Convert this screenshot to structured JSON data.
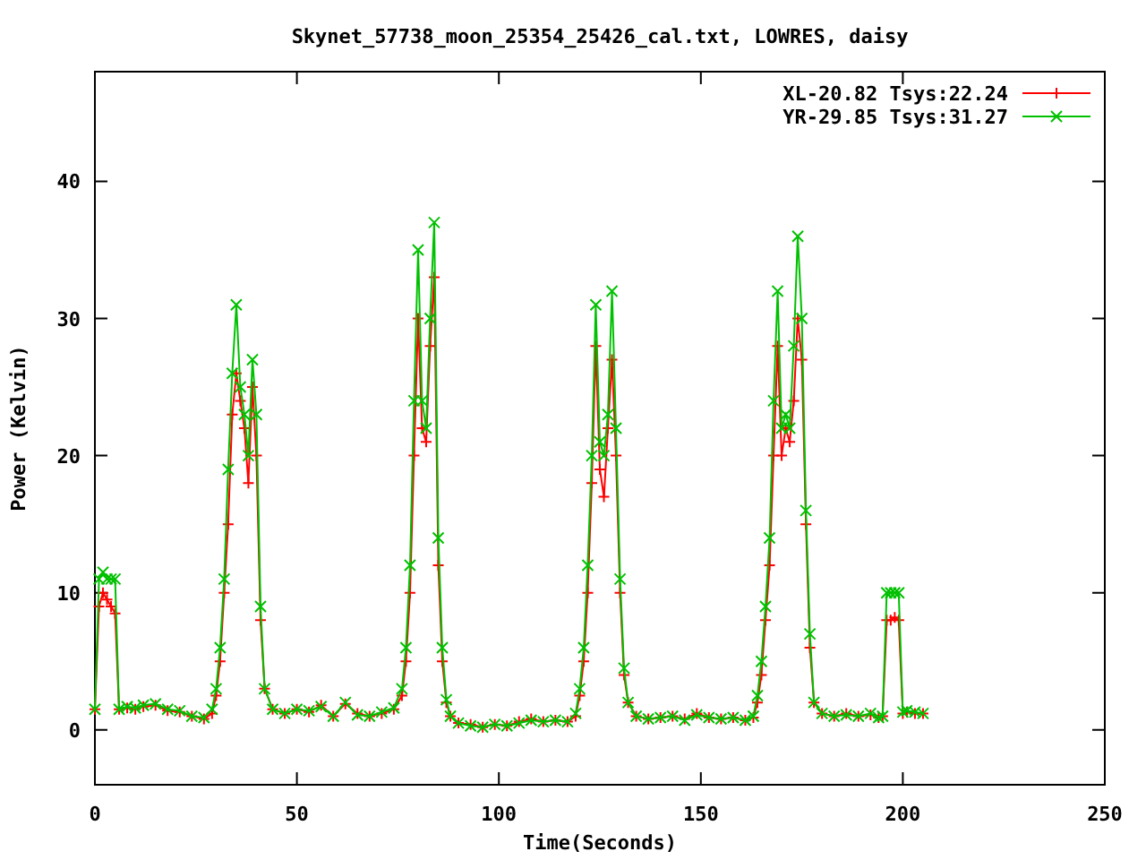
{
  "chart": {
    "chart_data": {
      "type": "line",
      "title": "Skynet_57738_moon_25354_25426_cal.txt, LOWRES, daisy",
      "xlabel": "Time(Seconds)",
      "ylabel": "Power (Kelvin)",
      "xlim": [
        0,
        250
      ],
      "ylim": [
        -4,
        48
      ],
      "xticks": [
        0,
        50,
        100,
        150,
        200,
        250
      ],
      "yticks": [
        0,
        10,
        20,
        30,
        40
      ],
      "legend": "top right",
      "x": [
        0,
        1,
        2,
        3,
        4,
        5,
        6,
        8,
        10,
        12,
        15,
        18,
        21,
        24,
        27,
        29,
        30,
        31,
        32,
        33,
        34,
        35,
        36,
        37,
        38,
        39,
        40,
        41,
        42,
        44,
        47,
        50,
        53,
        56,
        59,
        62,
        65,
        68,
        71,
        74,
        76,
        77,
        78,
        79,
        80,
        81,
        82,
        83,
        84,
        85,
        86,
        87,
        88,
        90,
        93,
        96,
        99,
        102,
        105,
        108,
        111,
        114,
        117,
        119,
        120,
        121,
        122,
        123,
        124,
        125,
        126,
        127,
        128,
        129,
        130,
        131,
        132,
        134,
        137,
        140,
        143,
        146,
        149,
        152,
        155,
        158,
        161,
        163,
        164,
        165,
        166,
        167,
        168,
        169,
        170,
        171,
        172,
        173,
        174,
        175,
        176,
        177,
        178,
        180,
        183,
        186,
        189,
        192,
        194,
        195,
        196,
        197,
        198,
        199,
        200,
        201,
        203,
        205
      ],
      "series": [
        {
          "name": "XL-20.82 Tsys:22.24",
          "color": "#ff0000",
          "marker": "plus",
          "values": [
            1.5,
            9,
            10,
            9.5,
            9,
            8.5,
            1.5,
            1.6,
            1.5,
            1.7,
            1.8,
            1.4,
            1.3,
            1.0,
            0.8,
            1.2,
            2.5,
            5,
            10,
            15,
            23,
            26,
            24,
            22,
            18,
            25,
            20,
            8,
            3,
            1.5,
            1.2,
            1.5,
            1.3,
            1.8,
            1.0,
            1.9,
            1.2,
            1.0,
            1.2,
            1.5,
            2.5,
            5,
            10,
            20,
            30,
            22,
            21,
            28,
            33,
            12,
            5,
            2,
            1,
            0.5,
            0.4,
            0.2,
            0.4,
            0.3,
            0.6,
            0.8,
            0.6,
            0.7,
            0.6,
            1,
            2.5,
            5,
            10,
            18,
            28,
            19,
            17,
            22,
            27,
            20,
            10,
            4,
            2,
            1,
            0.8,
            0.9,
            1,
            0.8,
            1.2,
            0.9,
            0.8,
            0.9,
            0.7,
            0.9,
            2,
            4,
            8,
            12,
            20,
            28,
            20,
            22,
            21,
            24,
            30,
            27,
            15,
            6,
            2,
            1.2,
            1,
            1.2,
            1,
            1.1,
            0.9,
            1,
            8,
            8,
            8.2,
            8,
            1.2,
            1.3,
            1.2,
            1.2
          ]
        },
        {
          "name": "YR-29.85 Tsys:31.27",
          "color": "#00c000",
          "marker": "cross",
          "values": [
            1.5,
            11,
            11.5,
            11,
            11,
            11,
            1.5,
            1.7,
            1.6,
            1.8,
            1.9,
            1.5,
            1.4,
            1.0,
            0.9,
            1.5,
            3,
            6,
            11,
            19,
            26,
            31,
            25,
            23,
            20,
            27,
            23,
            9,
            3,
            1.5,
            1.2,
            1.5,
            1.4,
            1.7,
            1.0,
            2,
            1.1,
            1.0,
            1.3,
            1.6,
            3,
            6,
            12,
            24,
            35,
            24,
            22,
            30,
            37,
            14,
            6,
            2.2,
            1,
            0.5,
            0.3,
            0.2,
            0.4,
            0.3,
            0.5,
            0.7,
            0.6,
            0.7,
            0.6,
            1.2,
            3,
            6,
            12,
            20,
            31,
            21,
            20,
            23,
            32,
            22,
            11,
            4.5,
            2,
            1,
            0.8,
            0.9,
            1,
            0.7,
            1.1,
            0.9,
            0.8,
            0.9,
            0.7,
            1,
            2.5,
            5,
            9,
            14,
            24,
            32,
            22,
            23,
            22,
            28,
            36,
            30,
            16,
            7,
            2,
            1.2,
            1,
            1.1,
            1,
            1.2,
            0.9,
            1,
            10,
            10,
            10,
            10,
            1.3,
            1.4,
            1.3,
            1.2
          ]
        }
      ]
    }
  }
}
